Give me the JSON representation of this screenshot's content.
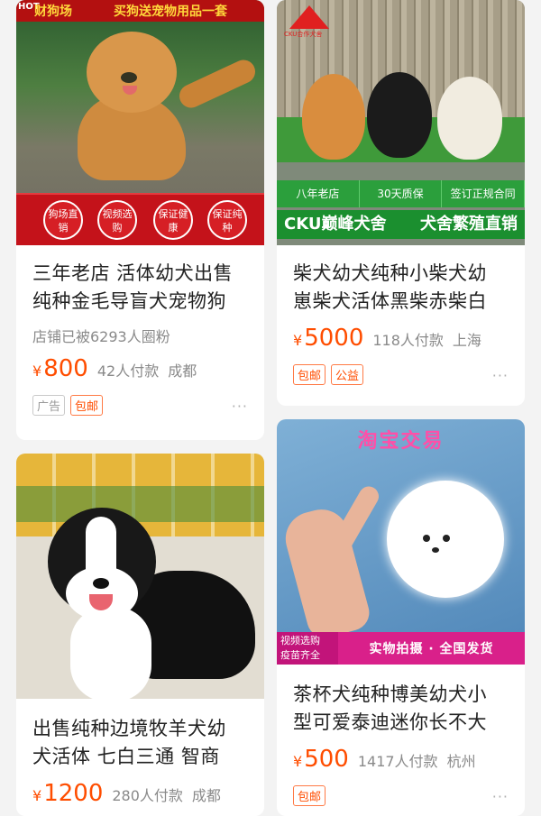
{
  "products": [
    {
      "image_top_left": "HOT",
      "image_top_left2": "财狗场",
      "image_top_right": "买狗送宠物用品一套",
      "image_badges": [
        "狗场直销",
        "视频选购",
        "保证健康",
        "保证纯种"
      ],
      "title_line1": "三年老店 活体幼犬出售",
      "title_line2": "纯种金毛导盲犬宠物狗",
      "shop_info": "店铺已被6293人圈粉",
      "price_symbol": "¥",
      "price": "800",
      "paid": "42人付款",
      "city": "成都",
      "tags": [
        "广告",
        "包邮"
      ],
      "more": "···"
    },
    {
      "image_logo_text": "CKU合作犬舍",
      "image_features": [
        "八年老店",
        "30天质保",
        "签订正规合同"
      ],
      "image_bottom_left": "CKU巅峰犬舍",
      "image_bottom_right": "犬舍繁殖直销",
      "title_line1": "柴犬幼犬纯种小柴犬幼",
      "title_line2": "崽柴犬活体黑柴赤柴白",
      "price_symbol": "¥",
      "price": "5000",
      "paid": "118人付款",
      "city": "上海",
      "tags": [
        "包邮",
        "公益"
      ],
      "more": "···"
    },
    {
      "title_line1": "出售纯种边境牧羊犬幼",
      "title_line2": "犬活体 七白三通 智商",
      "price_symbol": "¥",
      "price": "1200",
      "paid": "280人付款",
      "city": "成都"
    },
    {
      "image_title": "淘宝交易",
      "image_left_line1": "视频选购",
      "image_left_line2": "疫苗齐全",
      "image_right": "实物拍摄 · 全国发货",
      "title_line1": "茶杯犬纯种博美幼犬小",
      "title_line2": "型可爱泰迪迷你长不大",
      "price_symbol": "¥",
      "price": "500",
      "paid": "1417人付款",
      "city": "杭州",
      "tags": [
        "包邮"
      ],
      "more": "···"
    }
  ],
  "colors": {
    "price": "#ff4d00",
    "background": "#f3f3f3",
    "tag_border": "#ff7a45"
  }
}
